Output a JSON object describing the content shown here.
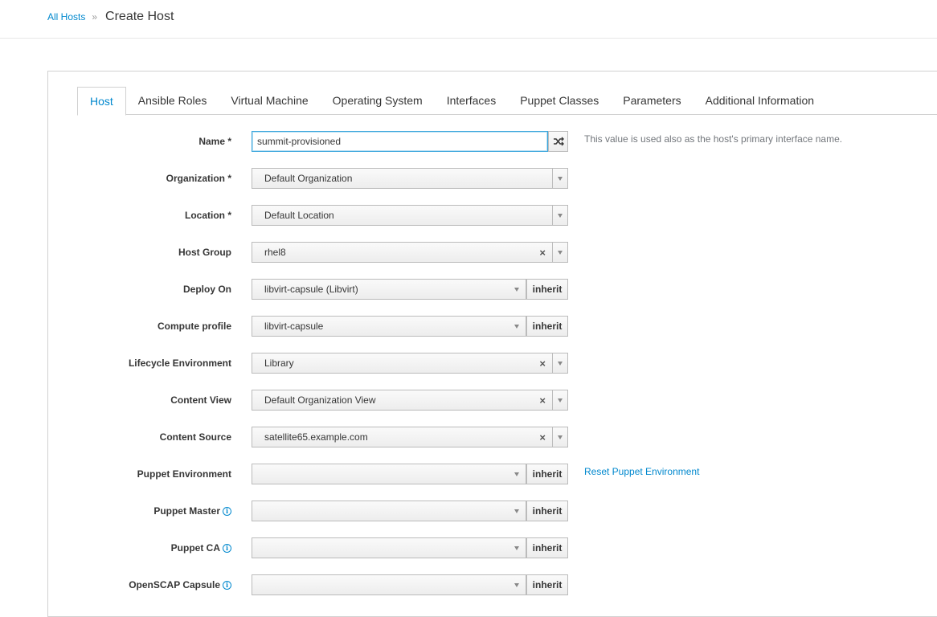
{
  "breadcrumb": {
    "parent": "All Hosts",
    "separator": "»",
    "current": "Create Host"
  },
  "tabs": [
    {
      "label": "Host",
      "active": true
    },
    {
      "label": "Ansible Roles"
    },
    {
      "label": "Virtual Machine"
    },
    {
      "label": "Operating System"
    },
    {
      "label": "Interfaces"
    },
    {
      "label": "Puppet Classes"
    },
    {
      "label": "Parameters"
    },
    {
      "label": "Additional Information"
    }
  ],
  "form": {
    "name": {
      "label": "Name *",
      "value": "summit-provisioned",
      "help": "This value is used also as the host's primary interface name.",
      "shuffle_icon": "shuffle-icon"
    },
    "organization": {
      "label": "Organization *",
      "value": "Default Organization"
    },
    "location": {
      "label": "Location *",
      "value": "Default Location"
    },
    "host_group": {
      "label": "Host Group",
      "value": "rhel8"
    },
    "deploy_on": {
      "label": "Deploy On",
      "value": "libvirt-capsule (Libvirt)",
      "button": "inherit"
    },
    "compute_profile": {
      "label": "Compute profile",
      "value": "libvirt-capsule",
      "button": "inherit"
    },
    "lifecycle_environment": {
      "label": "Lifecycle Environment",
      "value": "Library"
    },
    "content_view": {
      "label": "Content View",
      "value": "Default Organization View"
    },
    "content_source": {
      "label": "Content Source",
      "value": "satellite65.example.com"
    },
    "puppet_environment": {
      "label": "Puppet Environment",
      "value": "",
      "button": "inherit",
      "link": "Reset Puppet Environment"
    },
    "puppet_master": {
      "label": "Puppet Master",
      "value": "",
      "button": "inherit"
    },
    "puppet_ca": {
      "label": "Puppet CA",
      "value": "",
      "button": "inherit"
    },
    "openscap_capsule": {
      "label": "OpenSCAP Capsule",
      "value": "",
      "button": "inherit"
    }
  },
  "colors": {
    "link": "#0088ce",
    "border": "#bbbbbb",
    "focus": "#39a5dc"
  }
}
